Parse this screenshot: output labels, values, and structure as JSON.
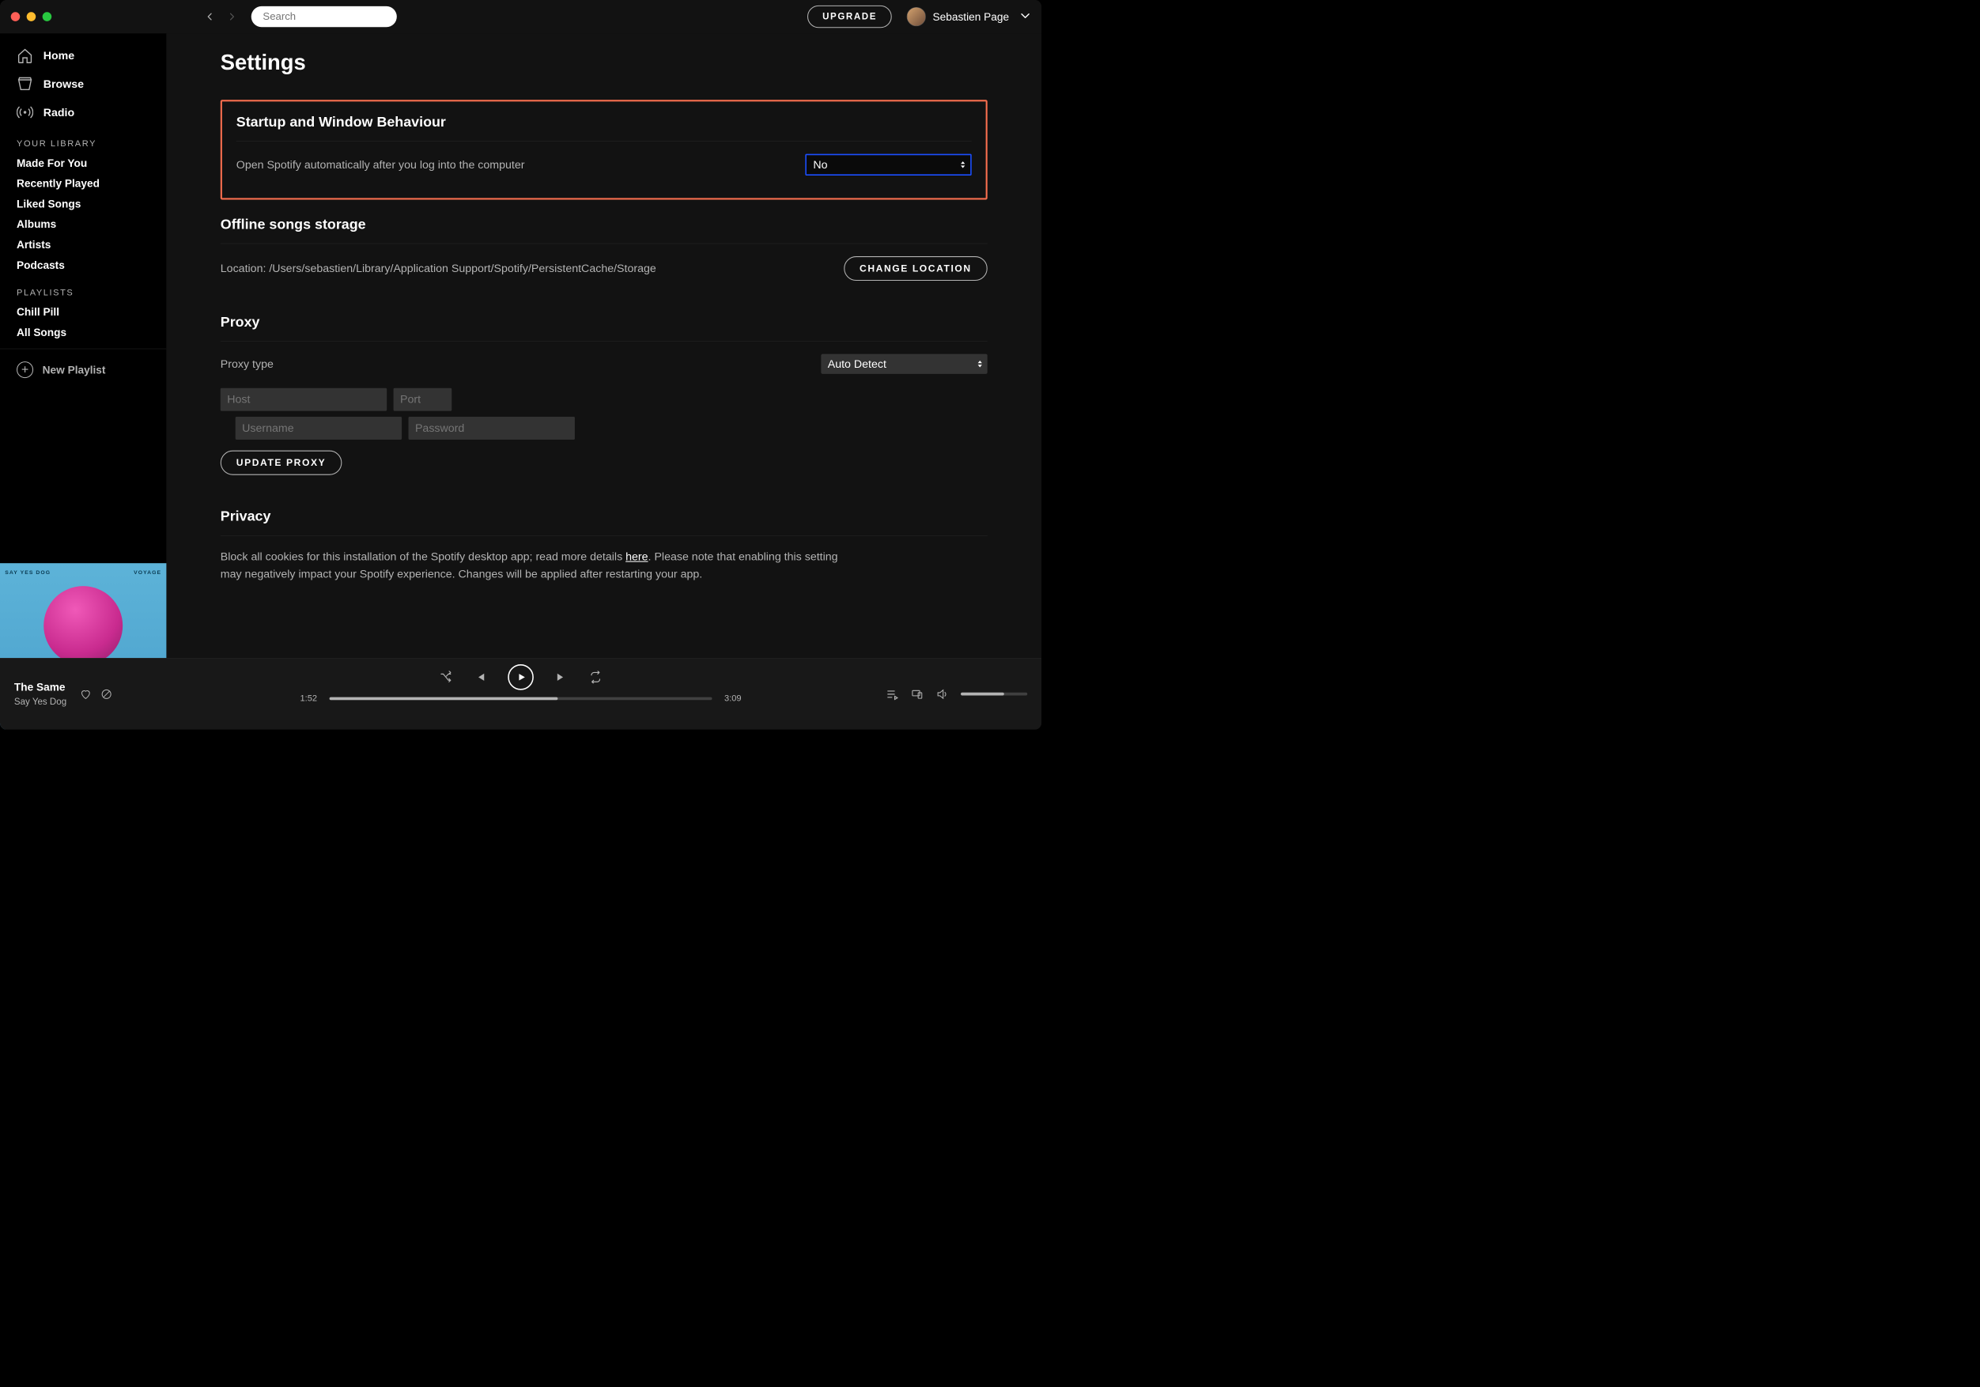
{
  "topbar": {
    "search_placeholder": "Search",
    "upgrade_label": "UPGRADE",
    "username": "Sebastien Page"
  },
  "sidebar": {
    "nav": {
      "home": "Home",
      "browse": "Browse",
      "radio": "Radio"
    },
    "library_heading": "YOUR LIBRARY",
    "library": [
      "Made For You",
      "Recently Played",
      "Liked Songs",
      "Albums",
      "Artists",
      "Podcasts"
    ],
    "playlists_heading": "PLAYLISTS",
    "playlists": [
      "Chill Pill",
      "All Songs"
    ],
    "new_playlist": "New Playlist"
  },
  "album_art": {
    "line1": "SAY YES DOG",
    "line2": "VOYAGE"
  },
  "settings": {
    "page_title": "Settings",
    "startup": {
      "heading": "Startup and Window Behaviour",
      "label": "Open Spotify automatically after you log into the computer",
      "value": "No"
    },
    "offline": {
      "heading": "Offline songs storage",
      "location": "Location: /Users/sebastien/Library/Application Support/Spotify/PersistentCache/Storage",
      "change_btn": "CHANGE LOCATION"
    },
    "proxy": {
      "heading": "Proxy",
      "type_label": "Proxy type",
      "type_value": "Auto Detect",
      "host_ph": "Host",
      "port_ph": "Port",
      "user_ph": "Username",
      "pass_ph": "Password",
      "update_btn": "UPDATE PROXY"
    },
    "privacy": {
      "heading": "Privacy",
      "text1": "Block all cookies for this installation of the Spotify desktop app; read more details ",
      "link": "here",
      "text2": ". Please note that enabling this setting may negatively impact your Spotify experience. Changes will be applied after restarting your app."
    }
  },
  "player": {
    "track": "The Same",
    "artist": "Say Yes Dog",
    "elapsed": "1:52",
    "duration": "3:09"
  }
}
